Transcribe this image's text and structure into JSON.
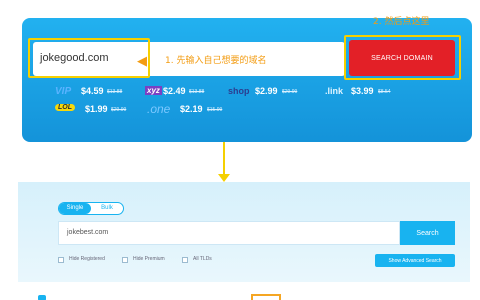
{
  "hero": {
    "note_step2": "2. 然后点这里",
    "domain_value": "jokegood.com",
    "note_step1": "1. 先输入自己想要的域名",
    "search_button": "SEARCH DOMAIN",
    "prices": [
      {
        "tld": "VIP",
        "price": "$4.59",
        "old": "$13.88"
      },
      {
        "tld": "xyz",
        "price": "$2.49",
        "old": "$13.88"
      },
      {
        "tld": "shop",
        "price": "$2.99",
        "old": "$29.99"
      },
      {
        "tld": ".link",
        "price": "$3.99",
        "old": "$8.54"
      },
      {
        "tld": "LOL",
        "price": "$1.99",
        "old": "$29.99"
      },
      {
        "tld": ".one",
        "price": "$2.19",
        "old": "$15.99"
      }
    ]
  },
  "search_panel": {
    "mode_single": "Single",
    "mode_bulk": "Bulk",
    "search_value": "jokebest.com",
    "search_button": "Search",
    "options": [
      "Hide Registered",
      "Hide Premium",
      "All TLDs"
    ],
    "advanced_button": "Show Advanced Search"
  },
  "colors": {
    "hero_blue": "#1fa8ec",
    "cta_red": "#e32027",
    "highlight_yellow": "#f5d000",
    "note_orange": "#f39c12",
    "accent_blue": "#18b3f0"
  }
}
